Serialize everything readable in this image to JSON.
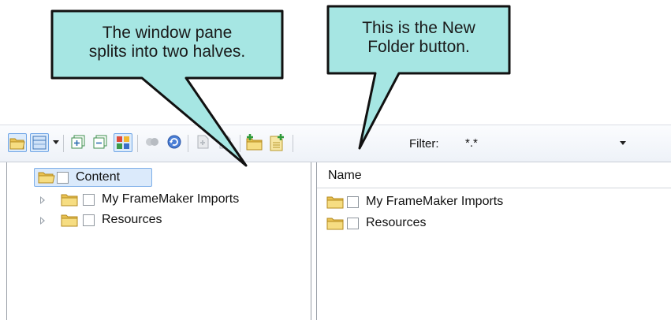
{
  "callouts": {
    "pane_split": {
      "line1": "The window pane",
      "line2": "splits into two halves."
    },
    "new_folder": {
      "line1": "This is the New",
      "line2": "Folder button."
    }
  },
  "toolbar": {
    "filter_label": "Filter:",
    "filter_value": "*.*",
    "icons": [
      "open-folder-icon",
      "view-mode-icon",
      "expand-all-icon",
      "collapse-all-icon",
      "thumbnail-view-icon",
      "bind-icon",
      "refresh-icon",
      "check-in-icon",
      "check-out-icon",
      "new-folder-icon",
      "new-file-icon"
    ]
  },
  "left_pane": {
    "tree": [
      {
        "label": "Content",
        "selected": true
      },
      {
        "label": "My FrameMaker Imports",
        "selected": false
      },
      {
        "label": "Resources",
        "selected": false
      }
    ]
  },
  "right_pane": {
    "column_header": "Name",
    "items": [
      {
        "label": "My FrameMaker Imports"
      },
      {
        "label": "Resources"
      }
    ]
  },
  "colors": {
    "callout_fill": "#a6e6e3",
    "callout_border": "#111111",
    "folder_yellow": "#f2cf59",
    "selection_blue": "#dbeafb"
  }
}
